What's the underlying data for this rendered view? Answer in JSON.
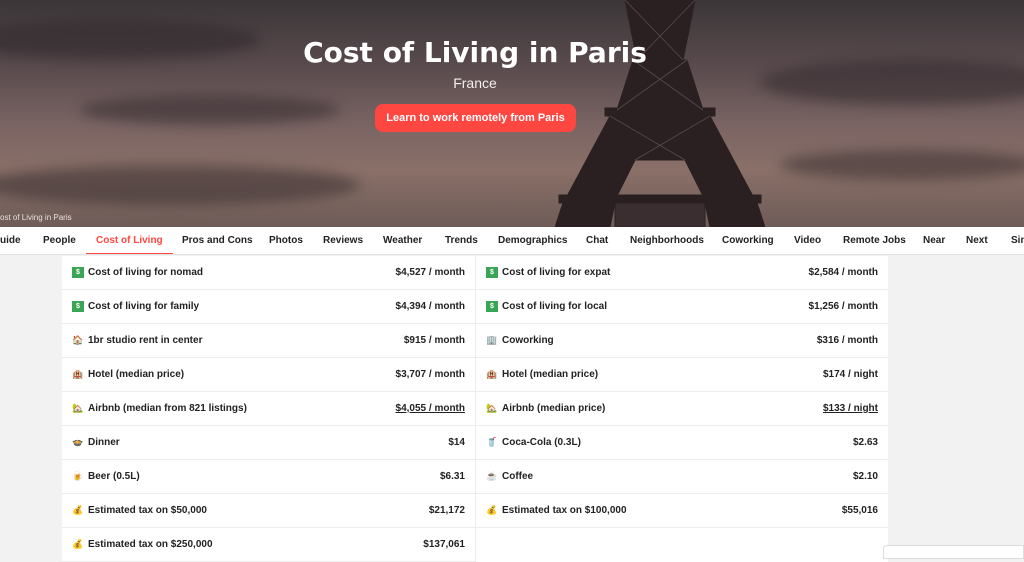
{
  "hero": {
    "title": "Cost of Living in Paris",
    "subtitle": "France",
    "cta": "Learn to work remotely from Paris",
    "caption": "ost of Living in Paris"
  },
  "tabs": [
    "uide",
    "People",
    "Cost of Living",
    "Pros and Cons",
    "Photos",
    "Reviews",
    "Weather",
    "Trends",
    "Demographics",
    "Chat",
    "Neighborhoods",
    "Coworking",
    "Video",
    "Remote Jobs",
    "Near",
    "Next",
    "Sin"
  ],
  "active_tab": "Cost of Living",
  "left": [
    {
      "icon": "cash-icon",
      "label": "Cost of living for nomad",
      "value": "$4,527 / month"
    },
    {
      "icon": "cash-icon",
      "label": "Cost of living for family",
      "value": "$4,394 / month"
    },
    {
      "icon": "house-icon",
      "label": "1br studio rent in center",
      "value": "$915 / month"
    },
    {
      "icon": "hotel-icon",
      "label": "Hotel (median price)",
      "value": "$3,707 / month"
    },
    {
      "icon": "house-icon",
      "label": "Airbnb (median from 821 listings)",
      "value": "$4,055 / month"
    },
    {
      "icon": "bowl-icon",
      "label": "Dinner",
      "value": "$14"
    },
    {
      "icon": "beer-icon",
      "label": "Beer (0.5L)",
      "value": "$6.31"
    },
    {
      "icon": "money-bag-icon",
      "label": "Estimated tax on $50,000",
      "value": "$21,172"
    },
    {
      "icon": "money-bag-icon",
      "label": "Estimated tax on $250,000",
      "value": "$137,061"
    }
  ],
  "right": [
    {
      "icon": "cash-icon",
      "label": "Cost of living for expat",
      "value": "$2,584 / month"
    },
    {
      "icon": "cash-icon",
      "label": "Cost of living for local",
      "value": "$1,256 / month"
    },
    {
      "icon": "office-icon",
      "label": "Coworking",
      "value": "$316 / month"
    },
    {
      "icon": "hotel-icon",
      "label": "Hotel (median price)",
      "value": "$174 / night"
    },
    {
      "icon": "house-icon",
      "label": "Airbnb (median price)",
      "value": "$133 / night"
    },
    {
      "icon": "soda-icon",
      "label": "Coca-Cola (0.3L)",
      "value": "$2.63"
    },
    {
      "icon": "coffee-icon",
      "label": "Coffee",
      "value": "$2.10"
    },
    {
      "icon": "money-bag-icon",
      "label": "Estimated tax on $100,000",
      "value": "$55,016"
    }
  ],
  "colors": {
    "accent": "#ff4742",
    "text": "#222222"
  }
}
